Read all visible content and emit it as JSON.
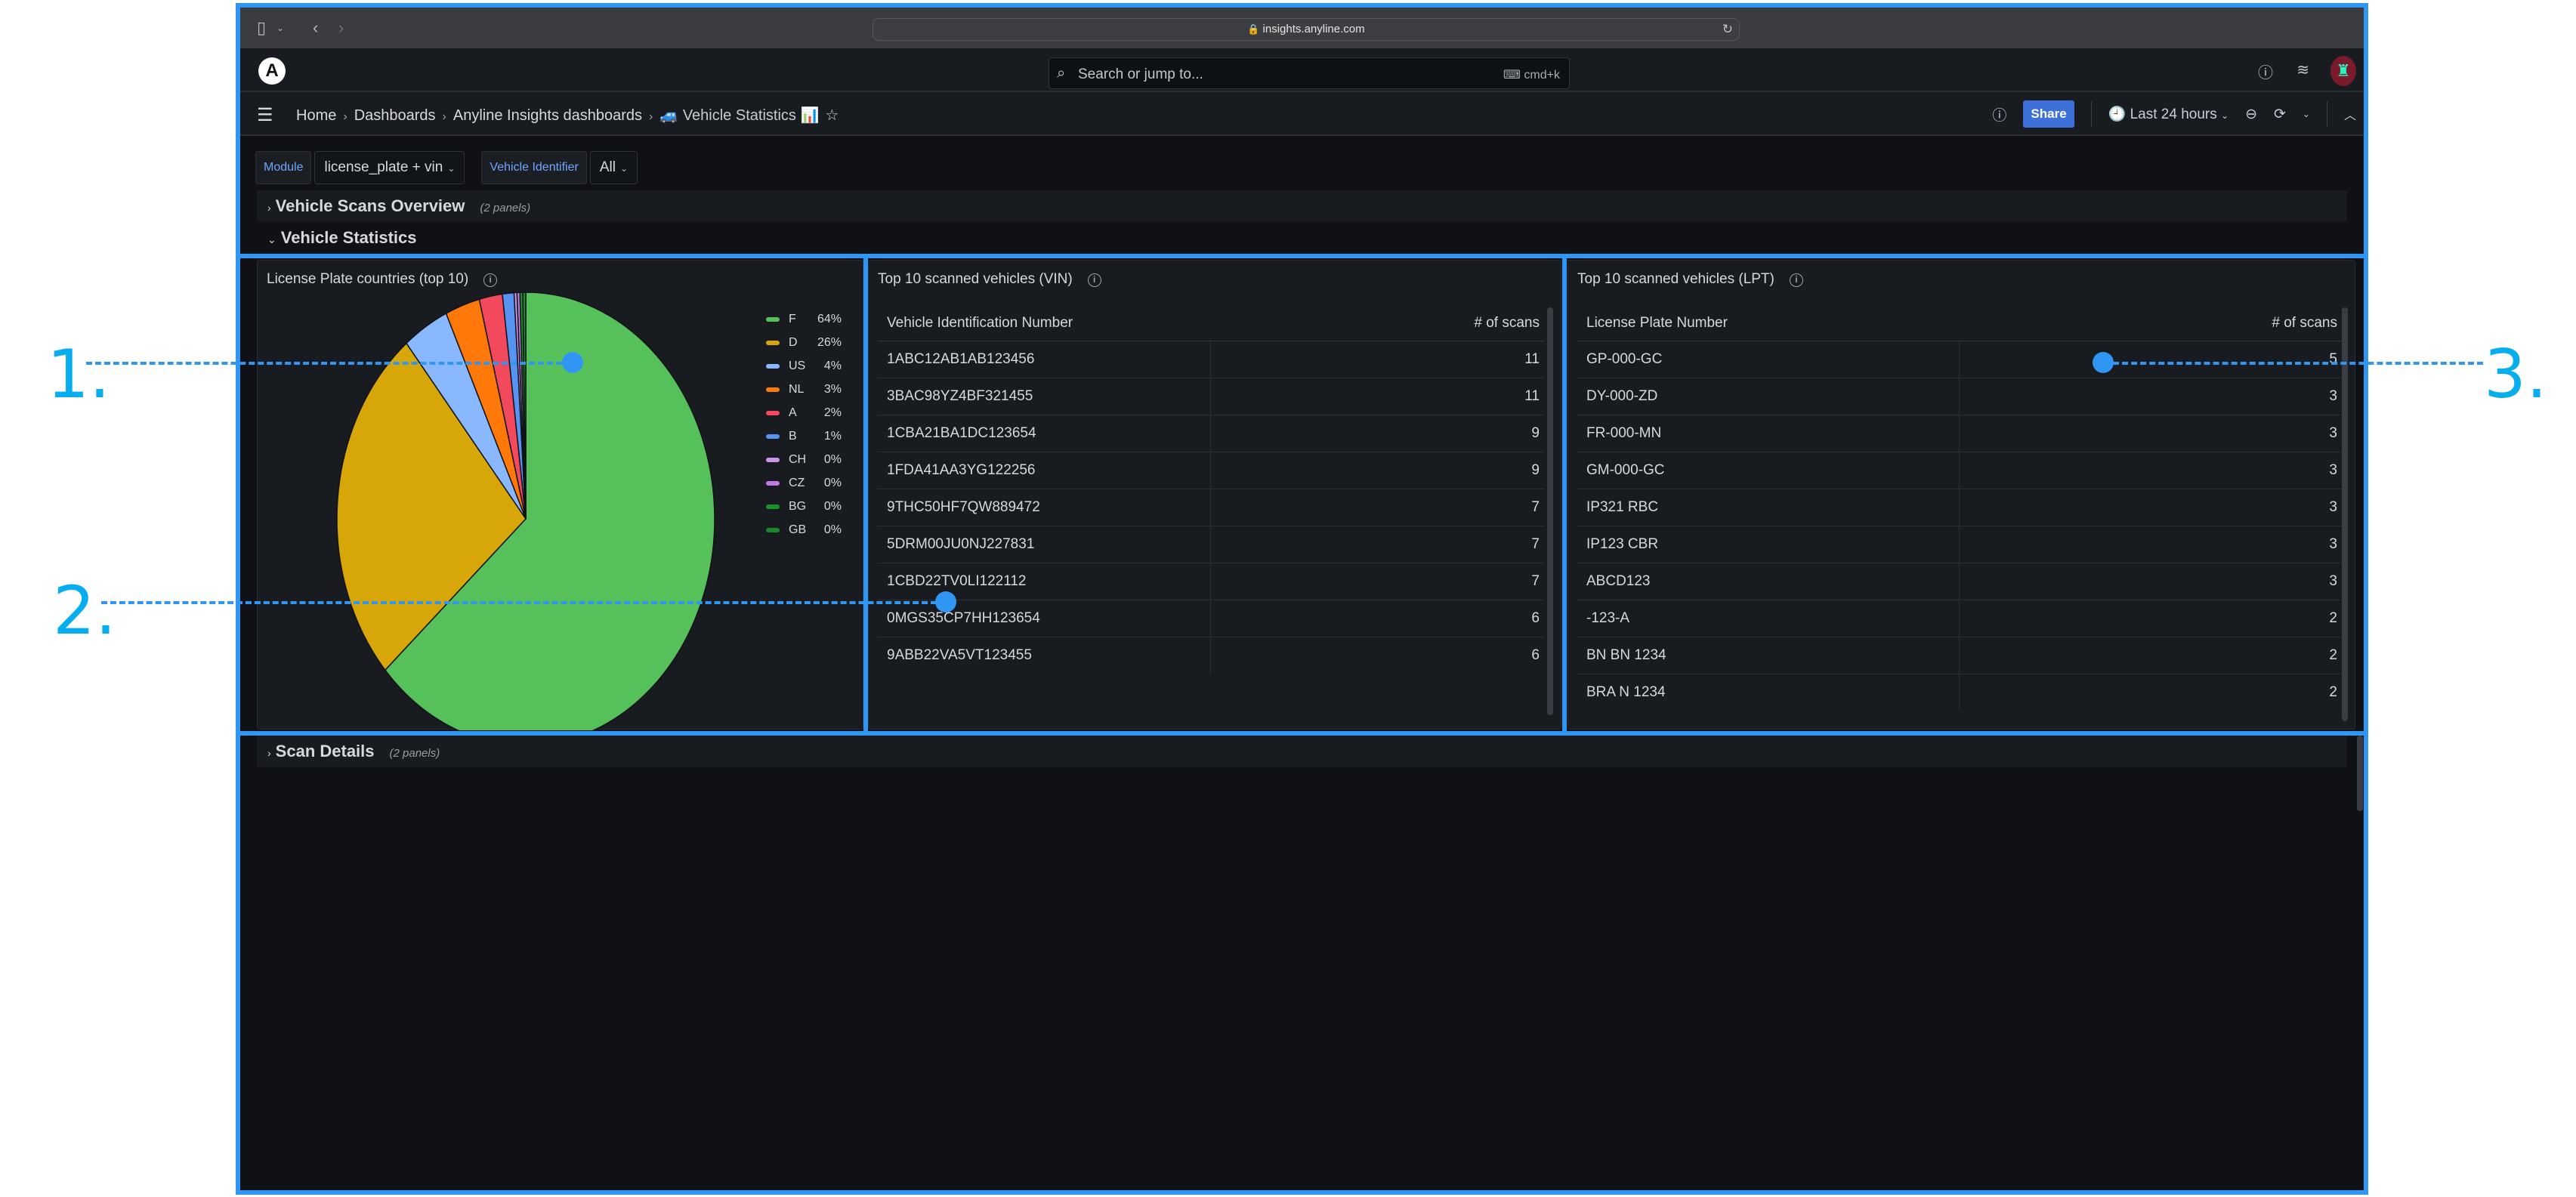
{
  "browser": {
    "url": "insights.anyline.com"
  },
  "topbar": {
    "search_placeholder": "Search or jump to...",
    "search_shortcut": "cmd+k",
    "icons": [
      "help-icon",
      "news-feed-icon",
      "user-avatar"
    ]
  },
  "breadcrumbs": {
    "items": [
      "Home",
      "Dashboards",
      "Anyline Insights dashboards"
    ],
    "current": "Vehicle Statistics",
    "current_emoji_prefix": "🚙",
    "current_emoji_suffix": "📊"
  },
  "toolbar": {
    "share_label": "Share",
    "time_range": "Last 24 hours"
  },
  "variables": [
    {
      "label": "Module",
      "value": "license_plate + vin"
    },
    {
      "label": "Vehicle Identifier",
      "value": "All"
    }
  ],
  "rows": [
    {
      "title": "Vehicle Scans Overview",
      "count": "(2 panels)",
      "collapsed": true
    },
    {
      "title": "Vehicle Statistics",
      "collapsed": false
    },
    {
      "title": "Scan Details",
      "count": "(2 panels)",
      "collapsed": true
    }
  ],
  "pie_panel": {
    "title": "License Plate countries (top 10)"
  },
  "chart_data": {
    "type": "pie",
    "title": "License Plate countries (top 10)",
    "legend_position": "right",
    "slices": [
      {
        "label": "F",
        "percent": 64,
        "color": "#56c15a"
      },
      {
        "label": "D",
        "percent": 26,
        "color": "#d7a70a"
      },
      {
        "label": "US",
        "percent": 4,
        "color": "#8ab8ff"
      },
      {
        "label": "NL",
        "percent": 3,
        "color": "#ff780a"
      },
      {
        "label": "A",
        "percent": 2,
        "color": "#f2495c"
      },
      {
        "label": "B",
        "percent": 1,
        "color": "#5794f2"
      },
      {
        "label": "CH",
        "percent": 0,
        "color": "#ca95e5"
      },
      {
        "label": "CZ",
        "percent": 0,
        "color": "#c27bdf"
      },
      {
        "label": "BG",
        "percent": 0,
        "color": "#19922b"
      },
      {
        "label": "GB",
        "percent": 0,
        "color": "#1b8a2f"
      }
    ]
  },
  "vin_panel": {
    "title": "Top 10 scanned vehicles (VIN)",
    "columns": [
      "Vehicle Identification Number",
      "# of scans"
    ],
    "rows": [
      [
        "1ABC12AB1AB123456",
        "11"
      ],
      [
        "3BAC98YZ4BF321455",
        "11"
      ],
      [
        "1CBA21BA1DC123654",
        "9"
      ],
      [
        "1FDA41AA3YG122256",
        "9"
      ],
      [
        "9THC50HF7QW889472",
        "7"
      ],
      [
        "5DRM00JU0NJ227831",
        "7"
      ],
      [
        "1CBD22TV0LI122112",
        "7"
      ],
      [
        "0MGS35CP7HH123654",
        "6"
      ],
      [
        "9ABB22VA5VT123455",
        "6"
      ]
    ]
  },
  "lpt_panel": {
    "title": "Top 10 scanned vehicles (LPT)",
    "columns": [
      "License Plate Number",
      "# of scans"
    ],
    "rows": [
      [
        "GP-000-GC",
        "5"
      ],
      [
        "DY-000-ZD",
        "3"
      ],
      [
        "FR-000-MN",
        "3"
      ],
      [
        "GM-000-GC",
        "3"
      ],
      [
        "IP321 RBC",
        "3"
      ],
      [
        "IP123 CBR",
        "3"
      ],
      [
        "ABCD123",
        "3"
      ],
      [
        "-123-A",
        "2"
      ],
      [
        "BN BN  1234",
        "2"
      ],
      [
        "BRA N 1234",
        "2"
      ]
    ]
  },
  "annotations": [
    "1.",
    "2.",
    "3."
  ]
}
